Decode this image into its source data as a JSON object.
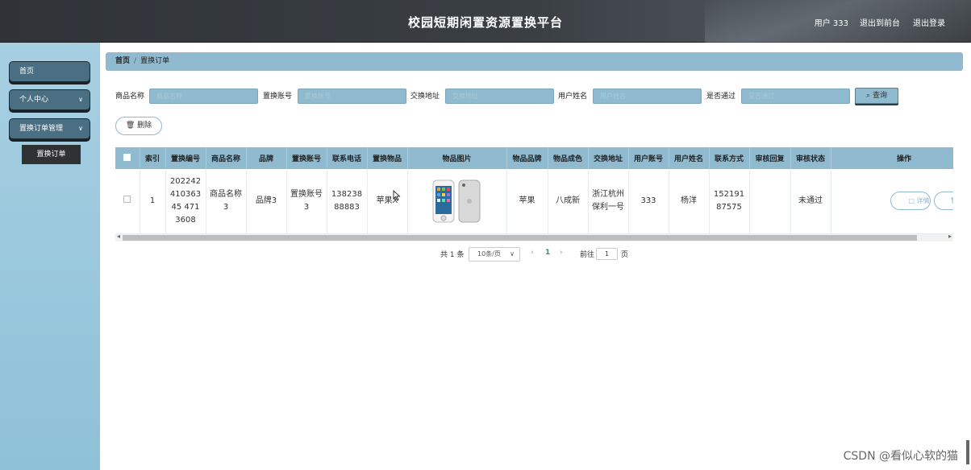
{
  "header": {
    "title": "校园短期闲置资源置换平台",
    "user": "用户 333",
    "front_link": "退出到前台",
    "logout_link": "退出登录"
  },
  "sidebar": {
    "items": [
      {
        "label": "首页"
      },
      {
        "label": "个人中心"
      },
      {
        "label": "置换订单管理"
      }
    ],
    "sub_item": "置换订单"
  },
  "breadcrumb": {
    "home": "首页",
    "current": "置换订单"
  },
  "search": {
    "fields": [
      {
        "label": "商品名称",
        "placeholder": "商品名称"
      },
      {
        "label": "置换账号",
        "placeholder": "置换账号"
      },
      {
        "label": "交换地址",
        "placeholder": "交换地址"
      },
      {
        "label": "用户姓名",
        "placeholder": "用户姓名"
      },
      {
        "label": "是否通过",
        "placeholder": "是否通过"
      }
    ],
    "query_button": "查询"
  },
  "toolbar": {
    "delete_button": "删除"
  },
  "table": {
    "headers": [
      "",
      "索引",
      "置换编号",
      "商品名称",
      "品牌",
      "置换账号",
      "联系电话",
      "置换物品",
      "物品图片",
      "物品品牌",
      "物品成色",
      "交换地址",
      "用户账号",
      "用户姓名",
      "联系方式",
      "审核回复",
      "审核状态",
      "操作"
    ],
    "rows": [
      {
        "index": "1",
        "code": "20224241036345 4713608",
        "product_name": "商品名称3",
        "brand": "品牌3",
        "swap_account": "置换账号3",
        "phone": "13823888883",
        "swap_item": "苹果X",
        "item_brand": "苹果",
        "condition": "八成新",
        "address": "浙江杭州保利一号",
        "user_account": "333",
        "user_name": "杨洋",
        "contact": "15219187575",
        "review_reply": "",
        "review_status": "未通过",
        "detail_button": "详情",
        "delete_button": "删除"
      }
    ]
  },
  "pagination": {
    "total": "共 1 条",
    "page_size": "10条/页",
    "current_page": "1",
    "goto_label": "前往",
    "goto_value": "1",
    "page_suffix": "页"
  },
  "watermark": "CSDN @看似心软的猫",
  "colors": {
    "accent": "#8fbad0",
    "header": "#33383d",
    "sidebar": "#9fc9dd"
  }
}
